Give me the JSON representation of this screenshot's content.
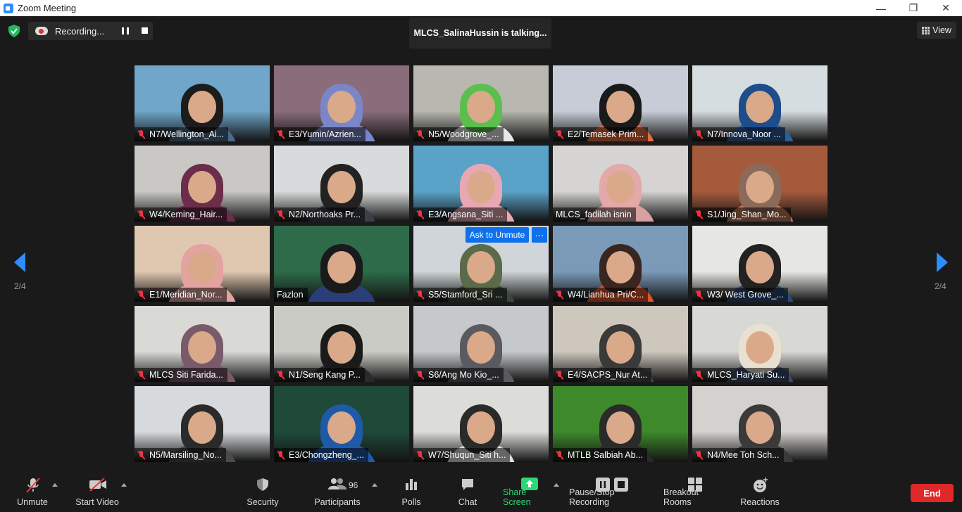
{
  "window": {
    "title": "Zoom Meeting",
    "controls": [
      "—",
      "❐",
      "✕"
    ]
  },
  "header": {
    "recording_label": "Recording...",
    "talking_banner": "MLCS_SalinaHussin is talking...",
    "view_label": "View"
  },
  "pagination": {
    "left": "2/4",
    "right": "2/4"
  },
  "participants": [
    {
      "name": "N7/Wellington_Ai...",
      "muted": true,
      "bg": "#6fa6c9",
      "hair": "#1c1c1c",
      "shirt": "#4a6a8a"
    },
    {
      "name": "E3/Yumin/Azrien...",
      "muted": true,
      "bg": "#8a6d7a",
      "hair": "#7b86c9",
      "shirt": "#7b86c9"
    },
    {
      "name": "N5/Woodgrove_...",
      "muted": true,
      "bg": "#b8b8b0",
      "hair": "#5bbf4e",
      "shirt": "#e8e8e8"
    },
    {
      "name": "E2/Temasek Prim...",
      "muted": true,
      "bg": "#c7ccd6",
      "hair": "#1a1a1a",
      "shirt": "#e86a3c"
    },
    {
      "name": "N7/Innova_Noor ...",
      "muted": true,
      "bg": "#d6dde0",
      "hair": "#1d4d8a",
      "shirt": "#2e5e9a"
    },
    {
      "name": "W4/Keming_Hair...",
      "muted": true,
      "bg": "#c9c8c4",
      "hair": "#6b2d4a",
      "shirt": "#6b2d4a"
    },
    {
      "name": "N2/Northoaks Pr...",
      "muted": true,
      "bg": "#d8dadb",
      "hair": "#222222",
      "shirt": "#3a3f4a"
    },
    {
      "name": "E3/Angsana_Siti ...",
      "muted": true,
      "bg": "#5aa3c8",
      "hair": "#e7a8b4",
      "shirt": "#e7a8b4"
    },
    {
      "name": "MLCS_fadilah isnin",
      "muted": false,
      "bg": "#d5d4d2",
      "hair": "#e3a8a8",
      "shirt": "#d8a0a0"
    },
    {
      "name": "S1/Jing_Shan_Mo...",
      "muted": true,
      "bg": "#a65a3c",
      "hair": "#8a6a5a",
      "shirt": "#c27a5a"
    },
    {
      "name": "E1/Meridian_Nor...",
      "muted": true,
      "bg": "#e0c8b0",
      "hair": "#e3a3a0",
      "shirt": "#e3a3a0"
    },
    {
      "name": "Fazlon",
      "muted": false,
      "bg": "#2e6b4a",
      "hair": "#1a1a1a",
      "shirt": "#2c3e7a"
    },
    {
      "name": "S5/Stamford_Sri ...",
      "muted": true,
      "bg": "#cfd5d8",
      "hair": "#5a6a4a",
      "shirt": "#3a4a3a"
    },
    {
      "name": "W4/Lianhua Pri/C...",
      "muted": true,
      "bg": "#7a9ab8",
      "hair": "#3a2620",
      "shirt": "#e0542a"
    },
    {
      "name": "W3/ West Grove_...",
      "muted": true,
      "bg": "#e6e6e2",
      "hair": "#222222",
      "shirt": "#2b4a7a"
    },
    {
      "name": "MLCS Siti Farida...",
      "muted": true,
      "bg": "#d9d9d6",
      "hair": "#7a5a6a",
      "shirt": "#7a5a6a"
    },
    {
      "name": "N1/Seng Kang P...",
      "muted": true,
      "bg": "#cbcbc6",
      "hair": "#1a1a1a",
      "shirt": "#2a2a2a"
    },
    {
      "name": "S6/Ang Mo Kio_...",
      "muted": true,
      "bg": "#c6c9cc",
      "hair": "#5a5a60",
      "shirt": "#5a5a60"
    },
    {
      "name": "E4/SACPS_Nur At...",
      "muted": true,
      "bg": "#cdc7bd",
      "hair": "#3a3a3a",
      "shirt": "#4a4a4a"
    },
    {
      "name": "MLCS_Haryati Su...",
      "muted": true,
      "bg": "#d8d8d4",
      "hair": "#e8e0d0",
      "shirt": "#3a4a6a"
    },
    {
      "name": "N5/Marsiling_No...",
      "muted": true,
      "bg": "#d6dadc",
      "hair": "#2a2a2a",
      "shirt": "#4a4a4a"
    },
    {
      "name": "E3/Chongzheng_...",
      "muted": true,
      "bg": "#1f4a3a",
      "hair": "#1e5aa8",
      "shirt": "#1e5aa8"
    },
    {
      "name": "W7/Shuqun_Siti h...",
      "muted": true,
      "bg": "#dcdcd8",
      "hair": "#2a2a2a",
      "shirt": "#e0e0e0"
    },
    {
      "name": "MTLB Salbiah Ab...",
      "muted": true,
      "bg": "#3e8a2a",
      "hair": "#2a2a2a",
      "shirt": "#2a2a2a"
    },
    {
      "name": "N4/Mee Toh Sch...",
      "muted": true,
      "bg": "#d4d2ce",
      "hair": "#3a3a3a",
      "shirt": "#3a3a3a"
    }
  ],
  "unmute_prompt": {
    "ask_label": "Ask to Unmute",
    "more_label": "···"
  },
  "toolbar": {
    "unmute": "Unmute",
    "start_video": "Start Video",
    "security": "Security",
    "participants": "Participants",
    "participants_count": "96",
    "polls": "Polls",
    "chat": "Chat",
    "share_screen": "Share Screen",
    "recording_control": "Pause/Stop Recording",
    "breakout_rooms": "Breakout Rooms",
    "reactions": "Reactions",
    "end": "End"
  },
  "colors": {
    "background": "#1a1a1a",
    "accent_blue": "#0e71eb",
    "share_green": "#2ed573",
    "end_red": "#e02828",
    "nav_arrow": "#2d8cff"
  }
}
